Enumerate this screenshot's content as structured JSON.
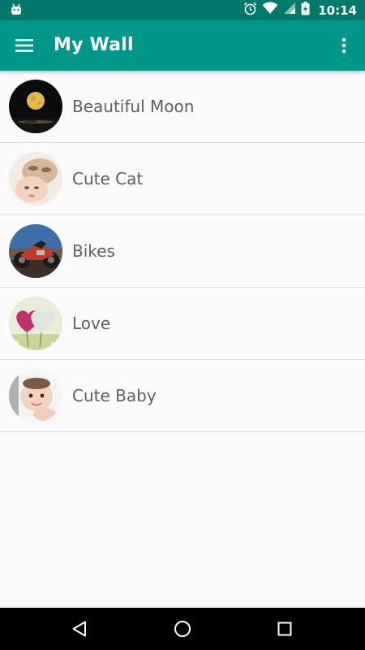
{
  "status_bar": {
    "time": "10:14",
    "icons": [
      "android-debug-icon",
      "alarm-icon",
      "wifi-icon",
      "signal-icon",
      "battery-icon"
    ]
  },
  "app_bar": {
    "title": "My Wall",
    "menu_icon": "hamburger-menu-icon",
    "overflow_icon": "more-vert-icon"
  },
  "list": {
    "items": [
      {
        "label": "Beautiful Moon",
        "thumbnail": "moon-thumbnail"
      },
      {
        "label": "Cute Cat",
        "thumbnail": "cat-thumbnail"
      },
      {
        "label": "Bikes",
        "thumbnail": "bike-thumbnail"
      },
      {
        "label": "Love",
        "thumbnail": "hearts-thumbnail"
      },
      {
        "label": "Cute Baby",
        "thumbnail": "baby-thumbnail"
      }
    ]
  },
  "nav_bar": {
    "buttons": [
      "back-icon",
      "home-icon",
      "recents-icon"
    ]
  },
  "colors": {
    "status_bar": "#00796B",
    "app_bar": "#009688",
    "background": "#FAFAFA",
    "divider": "#DADADA",
    "label_text": "#5F5F5F",
    "nav_bar": "#000000"
  }
}
